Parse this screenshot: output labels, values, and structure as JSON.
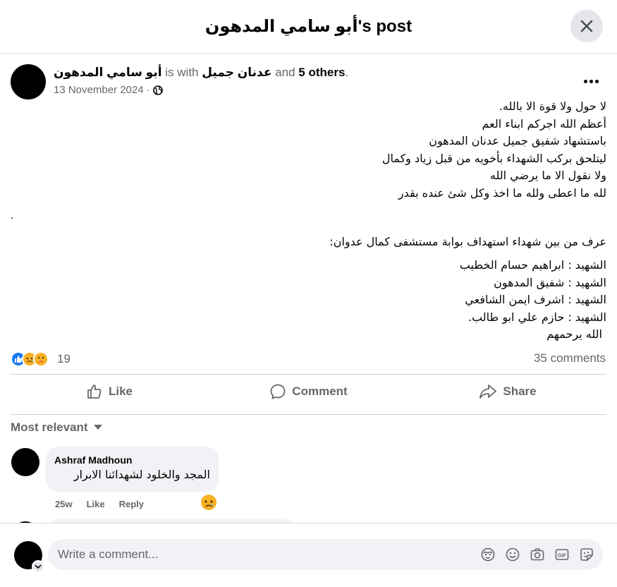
{
  "header": {
    "title": "أبو سامي المدهون's post"
  },
  "post": {
    "author": "أبو سامي المدهون",
    "with_text": "is with",
    "tagged_user": "عدنان جميل",
    "and_text": "and",
    "others": "5 others",
    "period": ".",
    "date": "13 November 2024",
    "separator": "·",
    "privacy_icon": "globe-icon",
    "body_lines": [
      "لا حول ولا قوة الا بالله.",
      "أعظم الله اجركم ابناء العم",
      "باستشهاد شفيق جميل عدنان المدهون",
      "ليتلحق بركب الشهداء بأخويه من قبل زياد وكمال",
      "ولا نقول الا ما يرضي الله",
      "لله ما اعطى ولله ما اخذ وكل شئ عنده بقدر"
    ],
    "dot": ".",
    "body2": "عرف من بين شهداء استهداف بوابة مستشفى كمال عدوان:",
    "body3_lines": [
      "الشهيد : ابراهيم حسام الخطيب",
      "الشهيد : شفيق المدهون",
      "الشهيد : اشرف ايمن الشافعي",
      "الشهيد : حازم علي ابو طالب.",
      "الله يرحمهم"
    ],
    "reaction_icons": [
      "like-icon",
      "sad-icon",
      "care-icon"
    ],
    "reaction_count": "19",
    "comments_count": "35 comments"
  },
  "actions": {
    "like": "Like",
    "comment": "Comment",
    "share": "Share"
  },
  "sort": {
    "label": "Most relevant"
  },
  "comments": [
    {
      "author": "Ashraf Madhoun",
      "text": "المجد والخلود لشهدائنا الابرار",
      "time": "25w",
      "like": "Like",
      "reply": "Reply",
      "reaction": "sad-icon"
    }
  ],
  "composer": {
    "placeholder": "Write a comment...",
    "icons": [
      "avatar-sticker-icon",
      "emoji-icon",
      "camera-icon",
      "gif-icon",
      "sticker-icon"
    ]
  },
  "colors": {
    "muted": "#65676b",
    "bubble": "#f0f2f5",
    "like_blue": "#1877f2",
    "sad_yellow": "#f7b125"
  }
}
